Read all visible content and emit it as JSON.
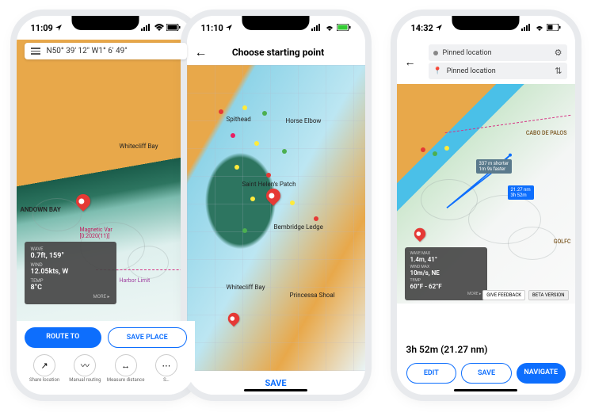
{
  "phone1": {
    "status_time": "11:09",
    "search_coords": "N50° 39' 12\" W1° 6' 49\"",
    "labels": {
      "whitecliff": "Whitecliff Bay",
      "andown": "ANDOWN BAY",
      "magnetic": "Magnetic Var",
      "magnetic_val": "[0.2020(11)]",
      "harbor": "Harbor Limit"
    },
    "weather": {
      "wave_lbl": "WAVE",
      "wave_val": "0.7ft, 159°",
      "wind_lbl": "WIND",
      "wind_val": "12.05kts, W",
      "temp_lbl": "TEMP",
      "temp_val": "8°C",
      "more": "MORE ▸"
    },
    "buttons": {
      "route_to": "ROUTE TO",
      "save_place": "SAVE PLACE"
    },
    "tools": {
      "share": "Share location",
      "manual": "Manual routing",
      "measure": "Measure distance",
      "extra": "S…"
    }
  },
  "phone2": {
    "status_time": "11:10",
    "title": "Choose starting point",
    "labels": {
      "spithead": "Spithead",
      "horse": "Horse Elbow",
      "sthelen": "Saint Helen's Patch",
      "bembridge": "Bembridge Ledge",
      "whitecliff": "Whitecliff Bay",
      "princessa": "Princessa Shoal"
    },
    "save": "SAVE"
  },
  "phone3": {
    "status_time": "14:32",
    "start": "Pinned location",
    "end": "Pinned location",
    "labels": {
      "cabo": "CABO DE PALOS",
      "golfc": "GOLFC"
    },
    "route_badge1_a": "337 m shorter",
    "route_badge1_b": "1m 9s faster",
    "route_badge2_a": "21.27 nm",
    "route_badge2_b": "3h 52m",
    "weather": {
      "wave_lbl": "WAVE MAX",
      "wave_val": "1.4m, 41°",
      "wind_lbl": "WIND MAX",
      "wind_val": "10m/s, NE",
      "temp_lbl": "TEMP",
      "temp_val": "60°F - 62°F",
      "more": "MORE ▸"
    },
    "feedback": "GIVE FEEDBACK",
    "beta": "BETA VERSION",
    "summary": "3h 52m (21.27 nm)",
    "buttons": {
      "edit": "EDIT",
      "save": "SAVE",
      "navigate": "NAVIGATE"
    }
  }
}
